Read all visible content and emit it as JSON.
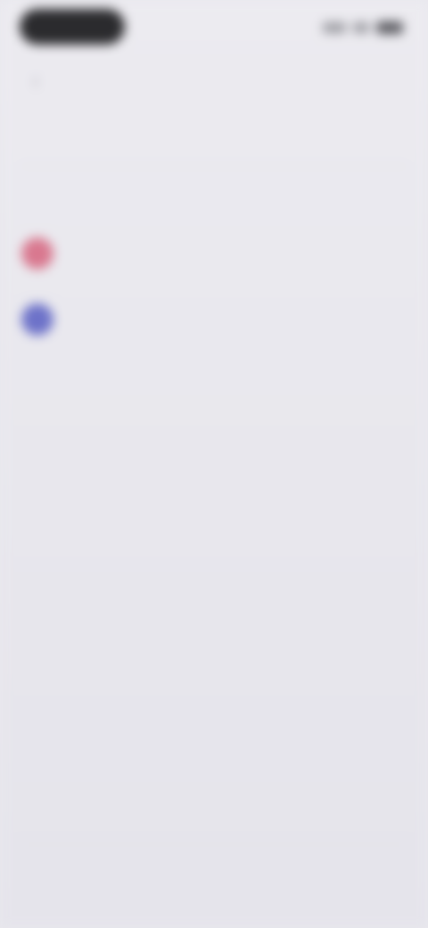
{
  "status_bar": {
    "icons": [
      "signal-icon",
      "wifi-icon",
      "battery-icon"
    ]
  },
  "nav": {
    "back_icon": "chevron-left-icon",
    "back_glyph": "‹"
  },
  "header": {
    "tab_active": "",
    "tab_secondary": "",
    "title": ""
  },
  "people": [
    {
      "name": "",
      "role": "",
      "avatar_color": "#d9788f"
    },
    {
      "name": "",
      "role": "",
      "avatar_color": "#6d72c9"
    }
  ],
  "sections": [
    {
      "heading": "",
      "body": ""
    },
    {
      "heading": "",
      "body": ""
    }
  ],
  "bottom_bar": {
    "action_label": ""
  },
  "colors": {
    "background": "#e9e8ee",
    "avatar_pink": "#d9788f",
    "avatar_blue": "#6d72c9"
  }
}
